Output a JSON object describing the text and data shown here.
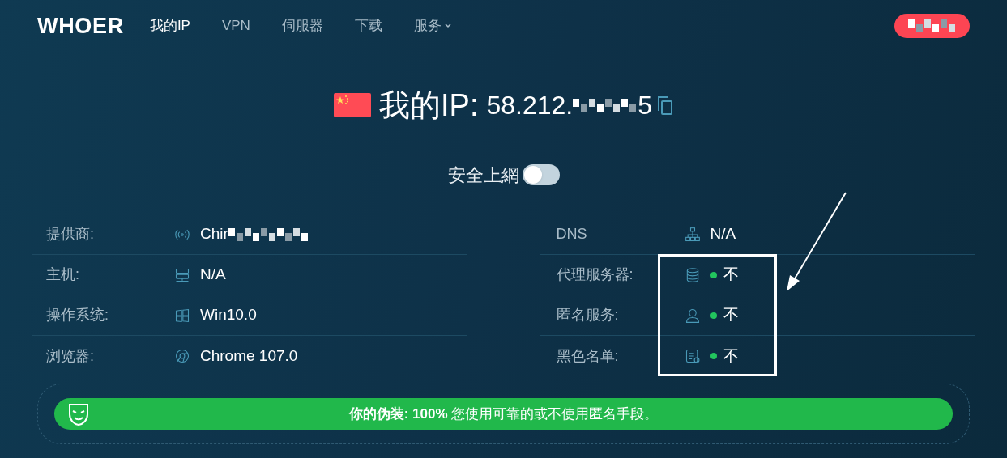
{
  "nav": {
    "logo": "WHOER",
    "items": [
      {
        "label": "我的IP",
        "selected": true,
        "dropdown": false
      },
      {
        "label": "VPN",
        "selected": false,
        "dropdown": false
      },
      {
        "label": "伺服器",
        "selected": false,
        "dropdown": false
      },
      {
        "label": "下载",
        "selected": false,
        "dropdown": false
      },
      {
        "label": "服务",
        "selected": false,
        "dropdown": true
      }
    ]
  },
  "ip": {
    "label": "我的IP:",
    "value_start": "58.212.",
    "value_end": "5"
  },
  "secure": {
    "label": "安全上網",
    "on": false
  },
  "left_rows": [
    {
      "kind": "wifi",
      "label": "提供商:",
      "value": "Chir",
      "redacted": true
    },
    {
      "kind": "server",
      "label": "主机:",
      "value": "N/A",
      "redacted": false
    },
    {
      "kind": "windows",
      "label": "操作系统:",
      "value": "Win10.0",
      "redacted": false
    },
    {
      "kind": "browser",
      "label": "浏览器:",
      "value": "Chrome 107.0",
      "redacted": false
    }
  ],
  "right_rows": [
    {
      "kind": "network",
      "label": "DNS",
      "value": "N/A"
    },
    {
      "kind": "database",
      "label": "代理服务器:",
      "value": "不",
      "color": "#22c55e"
    },
    {
      "kind": "person",
      "label": "匿名服务:",
      "value": "不",
      "color": "#22c55e"
    },
    {
      "kind": "list",
      "label": "黑色名单:",
      "value": "不",
      "color": "#22c55e"
    }
  ],
  "disguise": {
    "label": "你的伪装:",
    "percent": "100%",
    "text": "您使用可靠的或不使用匿名手段。"
  }
}
